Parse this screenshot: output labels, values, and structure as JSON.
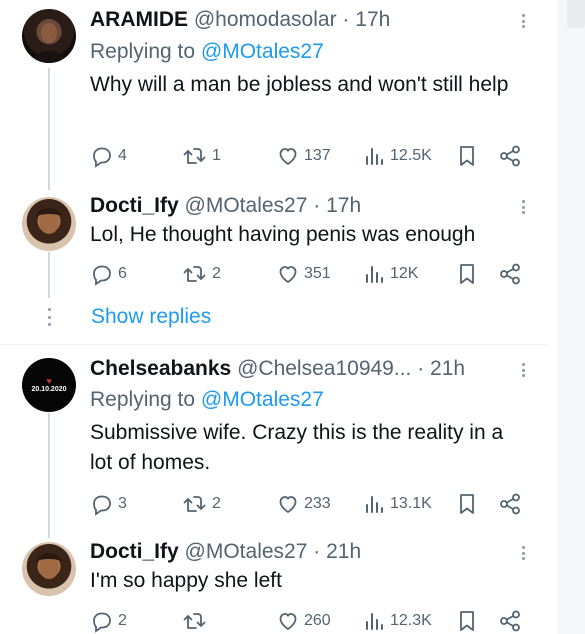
{
  "tweets": [
    {
      "name": "ARAMIDE",
      "handle": "@homodasolar",
      "dot": "·",
      "time": "17h",
      "replying_label": "Replying to",
      "replying_mention": "@MOtales27",
      "text": "Why will a man be jobless and won't still help",
      "replies": "4",
      "reposts": "1",
      "likes": "137",
      "views": "12.5K"
    },
    {
      "name": "Docti_Ify",
      "handle": "@MOtales27",
      "dot": "·",
      "time": "17h",
      "text": "Lol, He thought having penis was enough",
      "replies": "6",
      "reposts": "2",
      "likes": "351",
      "views": "12K"
    },
    {
      "name": "Chelseabanks",
      "handle": "@Chelsea10949...",
      "dot": "·",
      "time": "21h",
      "avatar_text": "20.10.2020",
      "replying_label": "Replying to",
      "replying_mention": "@MOtales27",
      "text": "Submissive wife. Crazy this is the reality in a lot of homes.",
      "replies": "3",
      "reposts": "2",
      "likes": "233",
      "views": "13.1K"
    },
    {
      "name": "Docti_Ify",
      "handle": "@MOtales27",
      "dot": "·",
      "time": "21h",
      "text": "I'm so happy she left",
      "replies": "2",
      "reposts": "",
      "likes": "260",
      "views": "12.3K"
    }
  ],
  "show_replies": "Show replies",
  "colors": {
    "accent": "#1d9bf0",
    "text": "#0f1419",
    "secondary": "#536471",
    "thread_line": "#cfd9de"
  }
}
